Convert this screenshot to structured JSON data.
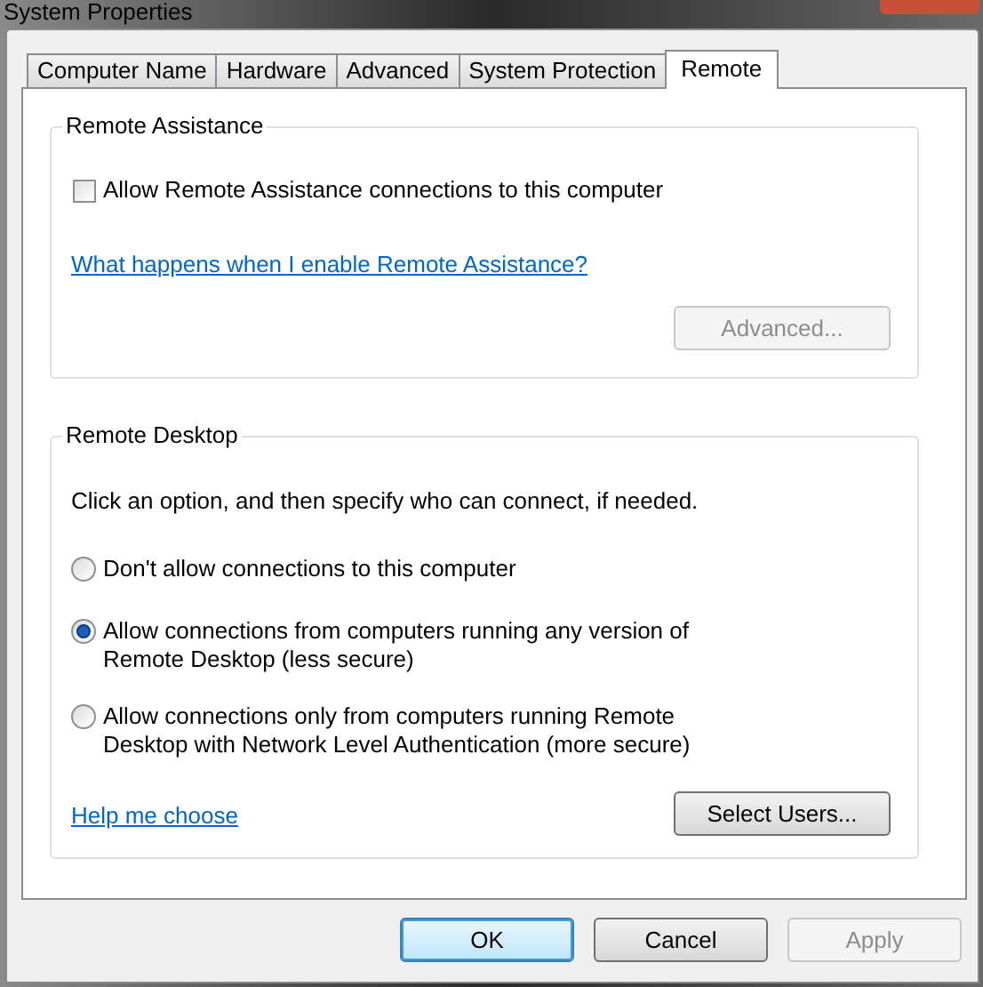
{
  "window": {
    "title": "System Properties"
  },
  "tabs": [
    {
      "label": "Computer Name",
      "selected": false
    },
    {
      "label": "Hardware",
      "selected": false
    },
    {
      "label": "Advanced",
      "selected": false
    },
    {
      "label": "System Protection",
      "selected": false
    },
    {
      "label": "Remote",
      "selected": true
    }
  ],
  "remote_assistance": {
    "title": "Remote Assistance",
    "checkbox": {
      "label": "Allow Remote Assistance connections to this computer",
      "checked": false
    },
    "link": "What happens when I enable Remote Assistance?",
    "button": {
      "label": "Advanced...",
      "disabled": true
    }
  },
  "remote_desktop": {
    "title": "Remote Desktop",
    "instructions": "Click an option, and then specify who can connect, if needed.",
    "options": [
      {
        "lines": [
          "Don't allow connections to this computer"
        ],
        "selected": false
      },
      {
        "lines": [
          "Allow connections from computers running any version of",
          "Remote Desktop (less secure)"
        ],
        "selected": true
      },
      {
        "lines": [
          "Allow connections only from computers running Remote",
          "Desktop with Network Level Authentication (more secure)"
        ],
        "selected": false
      }
    ],
    "link": "Help me choose",
    "button": {
      "label": "Select Users...",
      "disabled": false
    }
  },
  "buttons": [
    {
      "label": "OK",
      "kind": "default",
      "disabled": false
    },
    {
      "label": "Cancel",
      "kind": "normal",
      "disabled": false
    },
    {
      "label": "Apply",
      "kind": "normal",
      "disabled": true
    }
  ]
}
